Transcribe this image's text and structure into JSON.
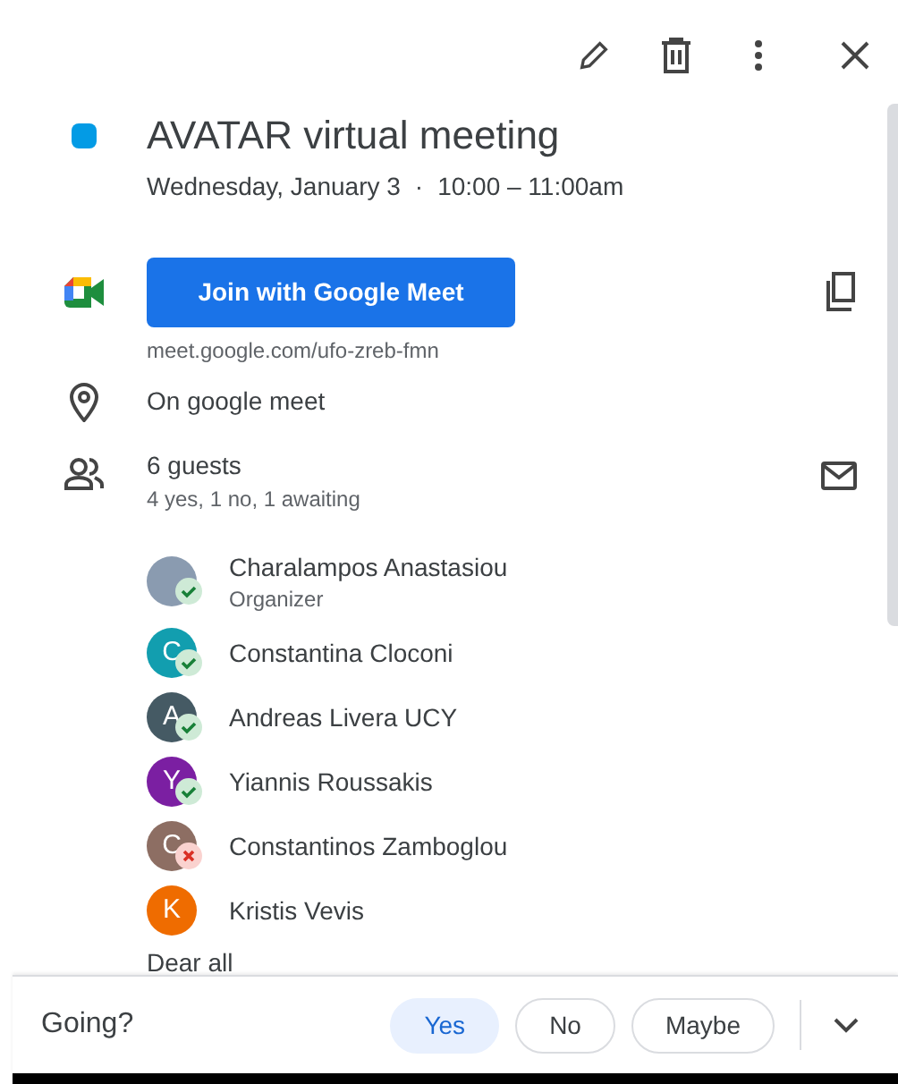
{
  "event": {
    "color": "#039be5",
    "title": "AVATAR virtual meeting",
    "date": "Wednesday, January 3",
    "separator": "·",
    "time": "10:00 – 11:00am"
  },
  "meet": {
    "button": "Join with Google Meet",
    "link": "meet.google.com/ufo-zreb-fmn"
  },
  "location": "On google meet",
  "guests": {
    "count": "6 guests",
    "summary": "4 yes, 1 no, 1 awaiting",
    "list": [
      {
        "name": "Charalampos Anastasiou",
        "role": "Organizer",
        "kind": "photo",
        "accepted": true,
        "declined": false
      },
      {
        "name": "Constantina Cloconi",
        "initial": "C",
        "kind": "initial",
        "color": "#129eaf",
        "accepted": true,
        "declined": false
      },
      {
        "name": "Andreas Livera UCY",
        "initial": "A",
        "kind": "initial",
        "color": "#455a64",
        "accepted": true,
        "declined": false
      },
      {
        "name": "Yiannis Roussakis",
        "initial": "Y",
        "kind": "initial",
        "color": "#7b1fa2",
        "accepted": true,
        "declined": false
      },
      {
        "name": "Constantinos Zamboglou",
        "initial": "C",
        "kind": "initial",
        "color": "#8d6e63",
        "accepted": false,
        "declined": true
      },
      {
        "name": "Kristis Vevis",
        "initial": "K",
        "kind": "initial",
        "color": "#ef6c00",
        "accepted": false,
        "declined": false
      }
    ]
  },
  "description": "Dear all",
  "footer": {
    "label": "Going?",
    "options": [
      {
        "label": "Yes",
        "selected": true
      },
      {
        "label": "No",
        "selected": false
      },
      {
        "label": "Maybe",
        "selected": false
      }
    ]
  }
}
